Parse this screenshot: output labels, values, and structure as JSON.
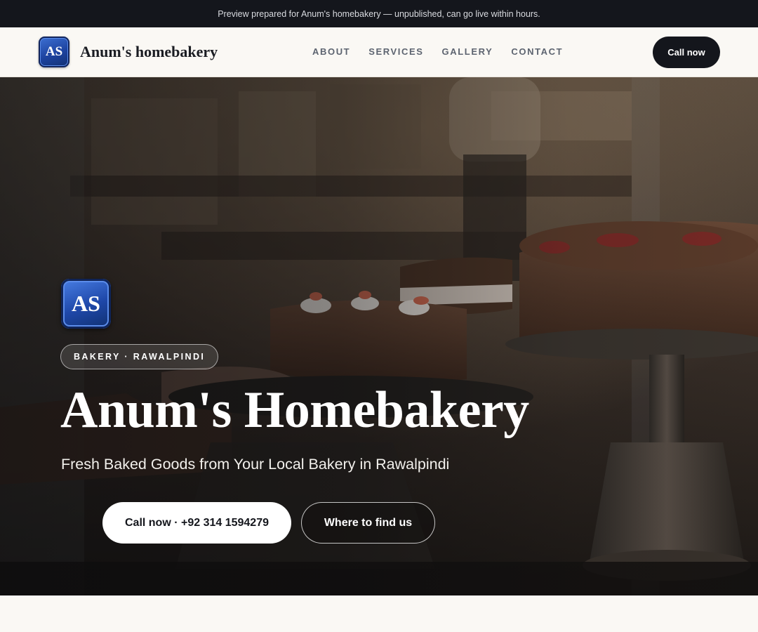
{
  "preview_bar": {
    "text": "Preview prepared for Anum's homebakery — unpublished, can go live within hours."
  },
  "header": {
    "logo_text": "AS",
    "brand": "Anum's homebakery",
    "nav": [
      {
        "label": "ABOUT"
      },
      {
        "label": "SERVICES"
      },
      {
        "label": "GALLERY"
      },
      {
        "label": "CONTACT"
      }
    ],
    "cta_label": "Call now"
  },
  "hero": {
    "logo_text": "AS",
    "tag": "BAKERY · RAWALPINDI",
    "title": "Anum's Homebakery",
    "subtitle": "Fresh Baked Goods from Your Local Bakery in Rawalpindi",
    "primary_button": "Call now · +92 314 1594279",
    "secondary_button": "Where to find us"
  },
  "colors": {
    "topbar_bg": "#14161c",
    "page_bg": "#faf8f4",
    "brand_blue": "#1d43a0",
    "button_dark": "#14161c"
  }
}
